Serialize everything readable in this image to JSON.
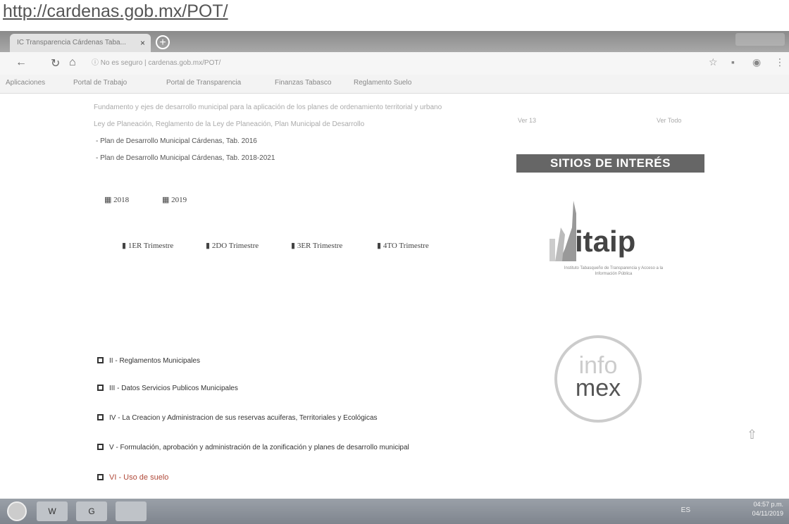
{
  "page_url_header": "http://cardenas.gob.mx/POT/",
  "browser": {
    "tab_title": "IC Transparencia Cárdenas Taba...",
    "tab_close": "×",
    "new_tab": "+",
    "address": "ⓘ   No es seguro  |  cardenas.gob.mx/POT/",
    "bookmarks": [
      "Aplicaciones",
      "Portal de Trabajo",
      "Portal de Transparencia",
      "Finanzas Tabasco",
      "Reglamento Suelo"
    ]
  },
  "content": {
    "faint_line_1": "Fundamento y ejes de desarrollo municipal para la aplicación de los planes de ordenamiento territorial y urbano",
    "faint_line_2": "Ley de Planeación, Reglamento de la Ley de Planeación, Plan Municipal de Desarrollo",
    "plans": [
      "Plan de Desarrollo Municipal Cárdenas, Tab. 2016",
      "Plan de Desarrollo Municipal Cárdenas, Tab. 2018-2021"
    ],
    "years": [
      "2018",
      "2019"
    ],
    "trimesters": [
      "1ER Trimestre",
      "2DO Trimestre",
      "3ER Trimestre",
      "4TO Trimestre"
    ],
    "sections": [
      "II - Reglamentos Municipales",
      "III - Datos Servicios Publicos Municipales",
      "IV - La Creacion y Administracion de sus reservas acuiferas, Territoriales y Ecológicas",
      "V - Formulación, aprobación y administración de la zonificación y planes de desarrollo municipal",
      "VI - Uso de suelo"
    ]
  },
  "sidebar": {
    "faint_left": "Ver 13",
    "faint_right": "Ver Todo",
    "heading": "SITIOS DE INTERÉS",
    "itaip_logo": "itaip",
    "itaip_caption": "Instituto Tabasqueño de Transparencia y Acceso a la Información Pública",
    "infomex_top": "info",
    "infomex_bottom": "mex"
  },
  "taskbar": {
    "lang": "ES",
    "time": "04:57 p.m.",
    "date": "04/11/2019",
    "apps": [
      "W",
      "G",
      ""
    ]
  },
  "colors": {
    "active_section": "#b04a3a",
    "heading_bg": "#666666"
  }
}
